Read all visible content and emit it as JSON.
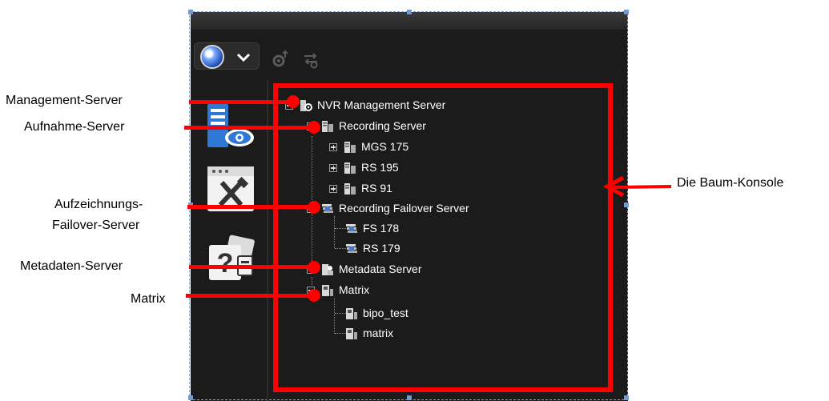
{
  "tree": {
    "nodes": [
      {
        "label": "NVR Management Server",
        "icon": "management-server-icon"
      },
      {
        "label": "Recording Server",
        "icon": "recording-server-icon"
      },
      {
        "label": "MGS 175",
        "icon": "server-icon"
      },
      {
        "label": "RS 195",
        "icon": "server-icon"
      },
      {
        "label": "RS 91",
        "icon": "server-icon"
      },
      {
        "label": "Recording Failover Server",
        "icon": "failover-server-icon"
      },
      {
        "label": "FS 178",
        "icon": "failover-server-icon"
      },
      {
        "label": "RS 179",
        "icon": "failover-server-icon"
      },
      {
        "label": "Metadata Server",
        "icon": "metadata-server-icon"
      },
      {
        "label": "Matrix",
        "icon": "matrix-icon"
      },
      {
        "label": "bipo_test",
        "icon": "matrix-icon"
      },
      {
        "label": "matrix",
        "icon": "matrix-icon"
      }
    ]
  },
  "callouts": {
    "management_server": "Management-Server",
    "recording_server": "Aufnahme-Server",
    "failover_line1": "Aufzeichnungs-",
    "failover_line2": "Failover-Server",
    "metadata_server": "Metadaten-Server",
    "matrix": "Matrix",
    "tree_console_prefix": "Die ",
    "tree_console_bold": "Baum-Konsole"
  },
  "colors": {
    "accent_red": "#ff0000",
    "panel_bg": "#1b1b1b",
    "tree_text": "#ffffff"
  }
}
